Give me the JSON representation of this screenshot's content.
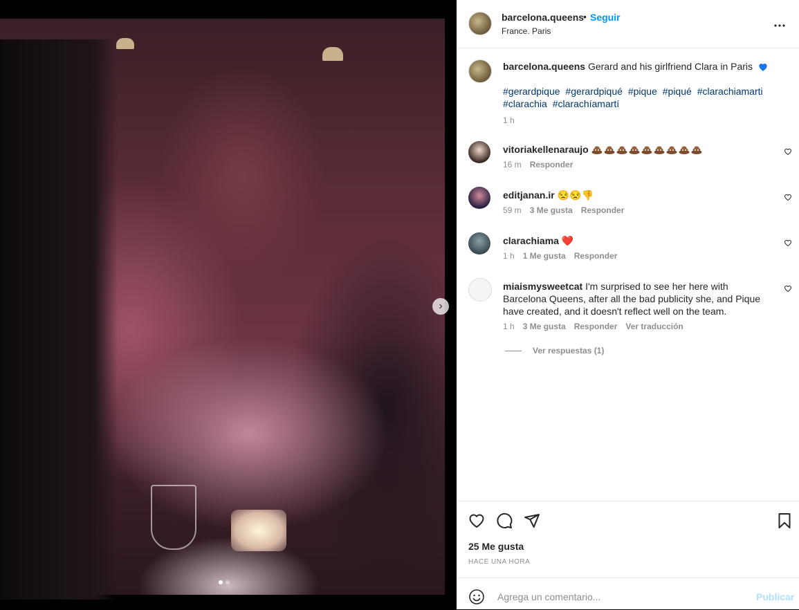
{
  "post": {
    "username": "barcelona.queens",
    "separator": "•",
    "follow_label": "Seguir",
    "location": "France. Paris",
    "more_label": "•••"
  },
  "media": {
    "next_label": "›",
    "slide_count": 2,
    "active_slide": 1
  },
  "caption": {
    "username": "barcelona.queens",
    "text": "Gerard and his girlfriend Clara in Paris",
    "emoji": "blue-heart",
    "hashtags": [
      "#gerardpique",
      "#gerardpiqué",
      "#pique",
      "#piqué",
      "#clarachiamarti",
      "#clarachia",
      "#clarachíamartí"
    ],
    "time": "1 h"
  },
  "comments": [
    {
      "username": "vitoriakellenaraujo",
      "text": "",
      "emoji": "poop",
      "emoji_count": 9,
      "time": "16 m",
      "likes": "",
      "reply": "Responder",
      "translate": ""
    },
    {
      "username": "editjanan.ir",
      "text": "😒😒👎",
      "time": "59 m",
      "likes": "3 Me gusta",
      "reply": "Responder",
      "translate": ""
    },
    {
      "username": "clarachiama",
      "text": "❤️",
      "time": "1 h",
      "likes": "1 Me gusta",
      "reply": "Responder",
      "translate": ""
    },
    {
      "username": "miaismysweetcat",
      "text": "I'm surprised to see her here with Barcelona Queens, after all the bad publicity she, and Pique have created, and it doesn't reflect well on the team.",
      "time": "1 h",
      "likes": "3 Me gusta",
      "reply": "Responder",
      "translate": "Ver traducción"
    }
  ],
  "view_replies": "Ver respuestas (1)",
  "likes_count": "25 Me gusta",
  "time_ago": "HACE UNA HORA",
  "composer": {
    "placeholder": "Agrega un comentario...",
    "publish_label": "Publicar"
  },
  "colors": {
    "accent": "#0095f6",
    "link": "#00376b",
    "muted": "#8e8e8e",
    "text": "#262626",
    "publish_disabled": "#b2dffc"
  },
  "icons": [
    "heart-icon",
    "comment-icon",
    "share-icon",
    "bookmark-icon",
    "smile-icon",
    "more-icon",
    "chevron-right-icon"
  ]
}
